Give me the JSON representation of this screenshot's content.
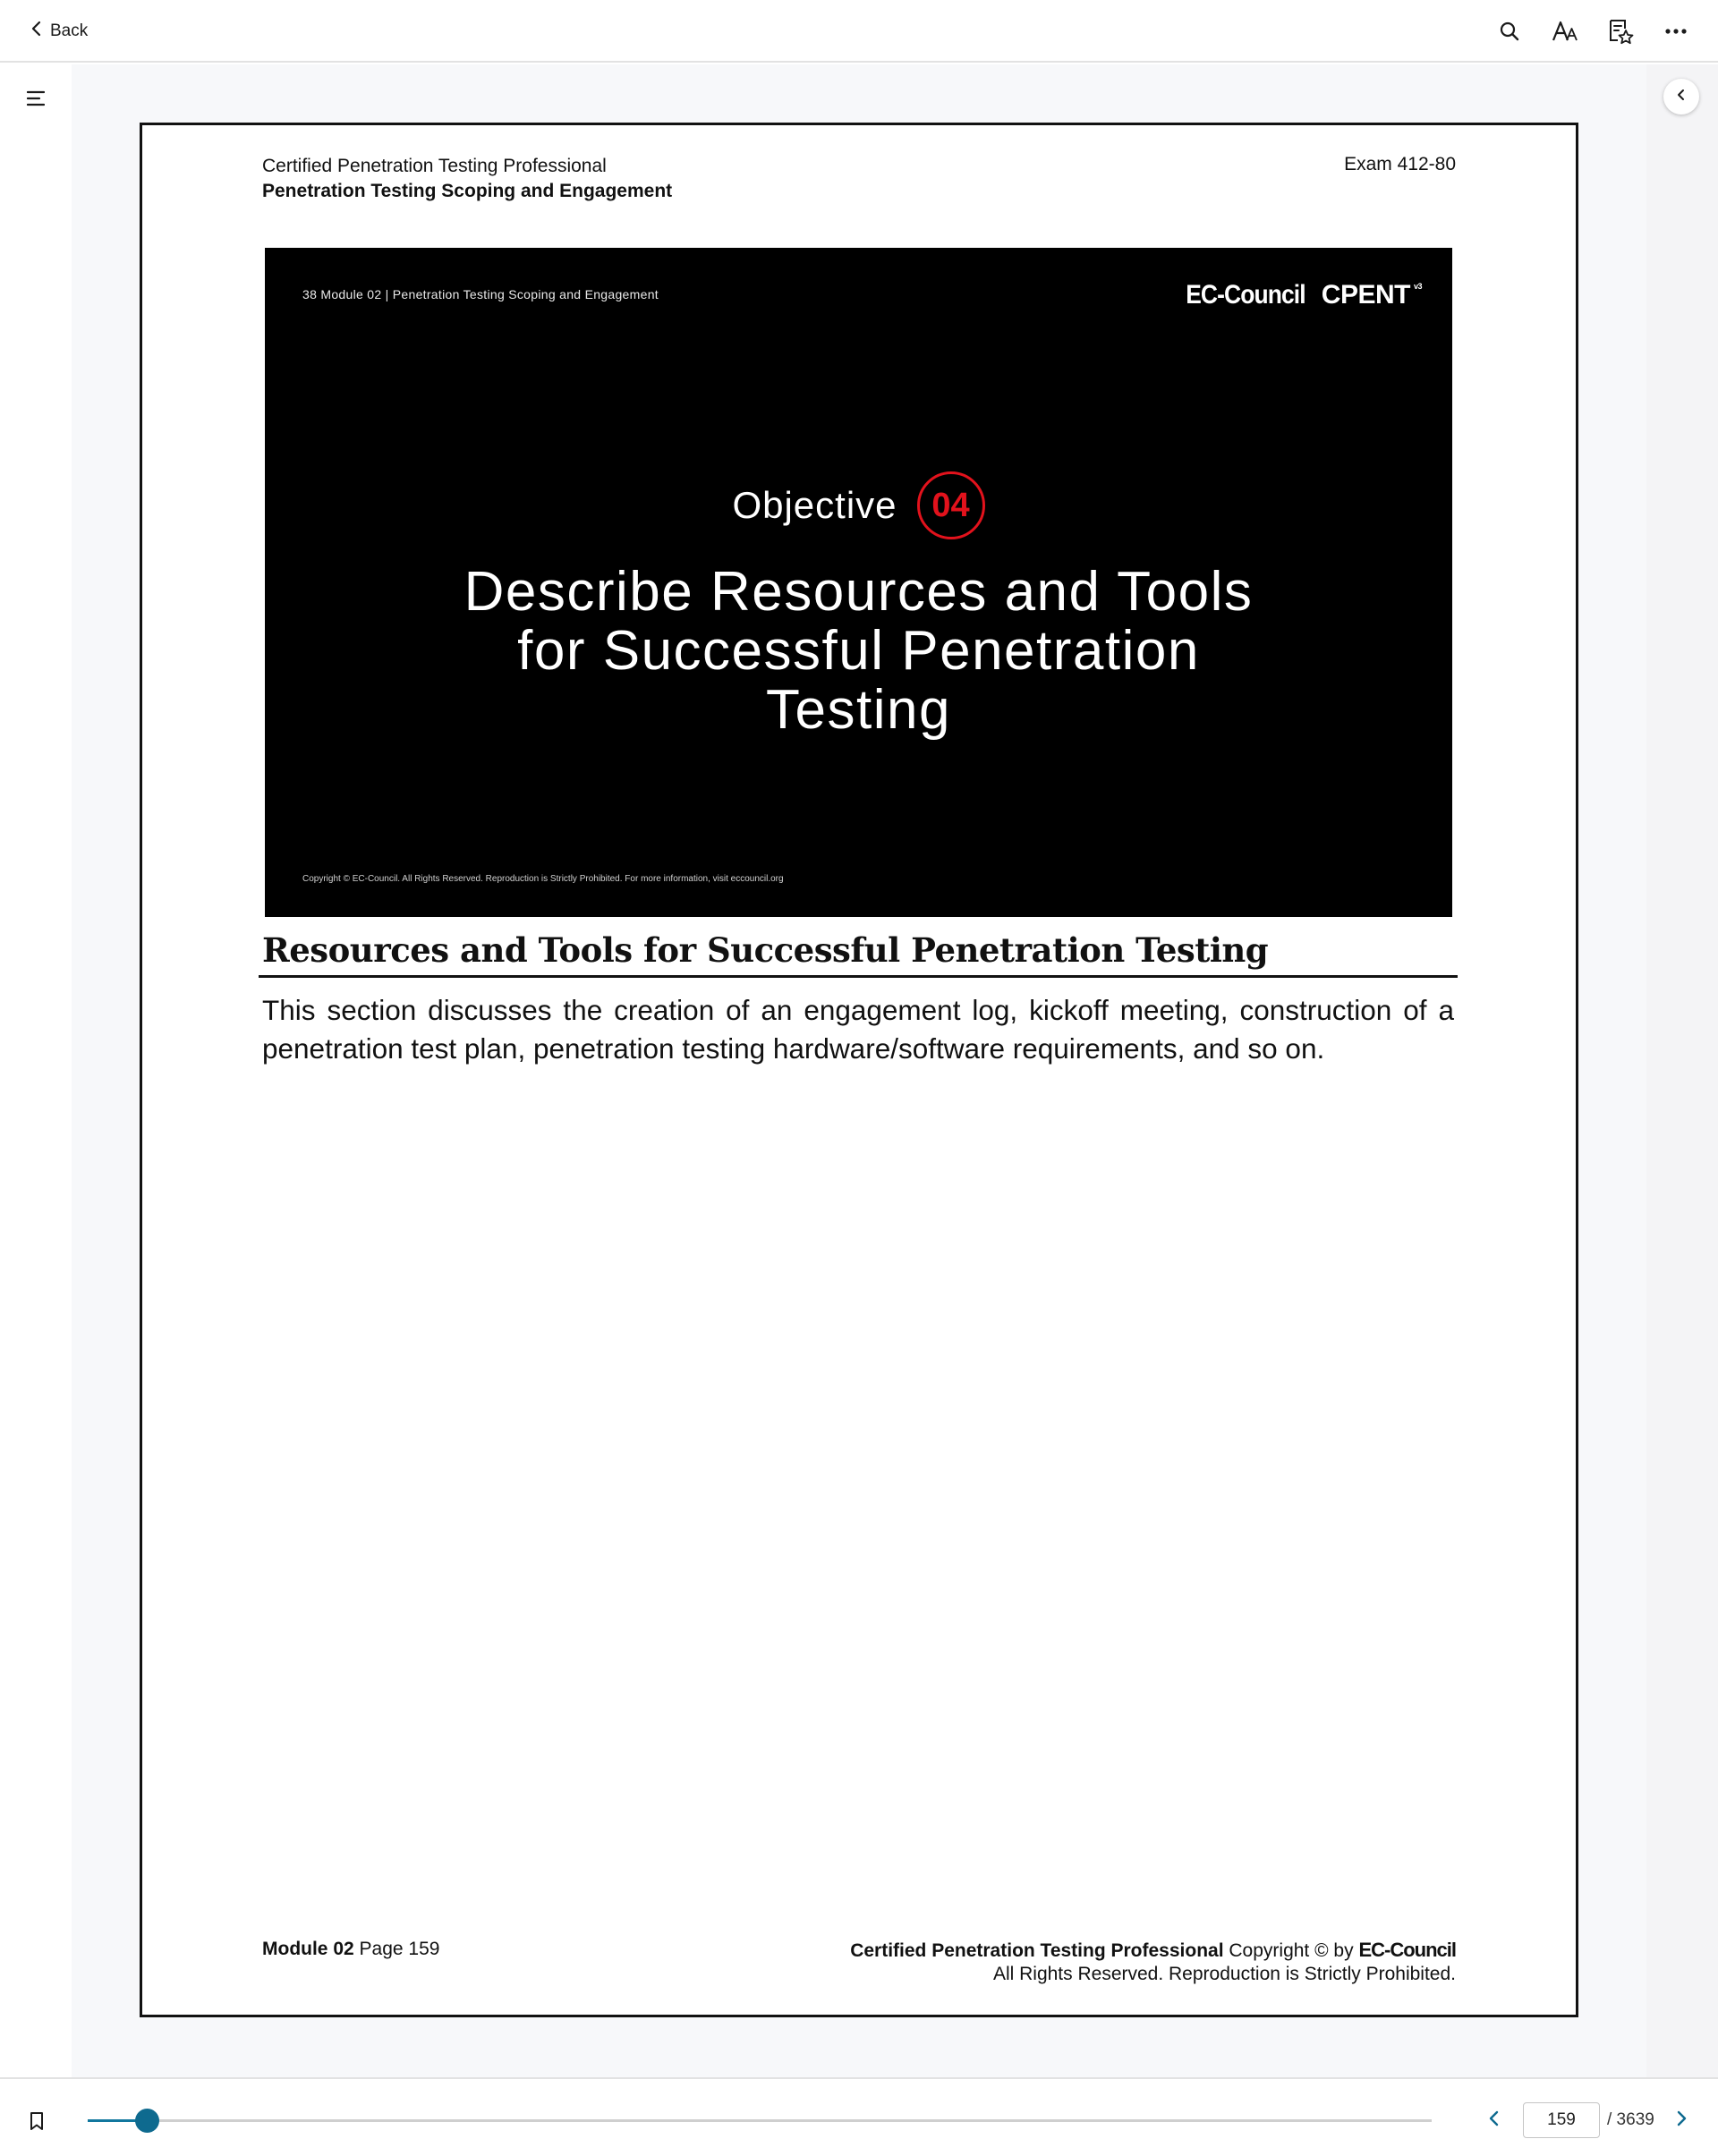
{
  "topbar": {
    "back_label": "Back",
    "icons": [
      "search-icon",
      "text-size-icon",
      "bookmarks-list-icon",
      "more-icon"
    ]
  },
  "page": {
    "header_line1": "Certified Penetration Testing Professional",
    "header_line2": "Penetration Testing Scoping and Engagement",
    "exam": "Exam 412-80",
    "slide": {
      "crumb": "38  Module 02 | Penetration Testing Scoping and Engagement",
      "logo_ec": "EC-Council",
      "logo_cpent": "CPENT",
      "logo_cpent_sup": "v3",
      "objective_label": "Objective",
      "objective_number": "04",
      "title_line1": "Describe Resources and Tools",
      "title_line2": "for Successful Penetration",
      "title_line3": "Testing",
      "copyright": "Copyright © EC-Council. All Rights Reserved. Reproduction is Strictly Prohibited. For more information, visit eccouncil.org"
    },
    "section_title": "Resources and Tools for Successful Penetration Testing",
    "body": "This section discusses the creation of an engagement log, kickoff meeting, construction of a penetration test plan, penetration testing hardware/software requirements, and so on.",
    "footer": {
      "module": "Module 02",
      "page": "Page 159",
      "course": "Certified Penetration Testing Professional",
      "copyright_by": "Copyright © by",
      "brand": "EC-Council",
      "rights": "All Rights Reserved. Reproduction is Strictly Prohibited."
    }
  },
  "bottombar": {
    "current_page": "159",
    "total_pages": "/ 3639",
    "progress_fraction": 0.044
  },
  "colors": {
    "accent": "#0e6a8f",
    "objective_red": "#e2121c"
  }
}
